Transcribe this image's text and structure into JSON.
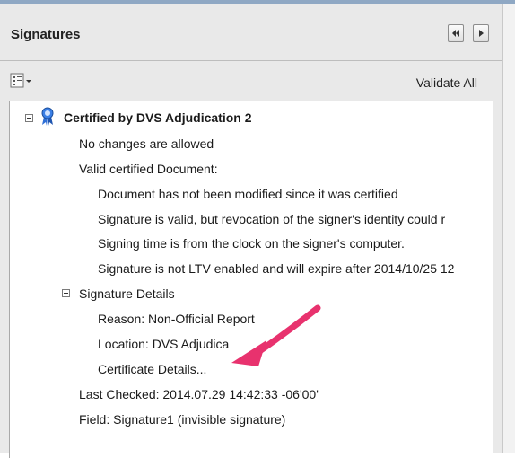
{
  "panel": {
    "title": "Signatures",
    "validate_all": "Validate All"
  },
  "tree": {
    "certified": "Certified by DVS Adjudication 2",
    "no_changes": "No changes are allowed",
    "valid_certified": "Valid certified Document:",
    "not_modified": "Document has not been modified since it was certified",
    "sig_valid": "Signature is valid, but revocation of the signer's identity could r",
    "signing_time": "Signing time is from the clock on the signer's computer.",
    "not_ltv": "Signature is not LTV enabled and will expire after 2014/10/25 12",
    "sig_details": "Signature Details",
    "reason": "Reason: Non-Official Report",
    "location": "Location: DVS Adjudica",
    "cert_details": "Certificate Details...",
    "last_checked": "Last Checked: 2014.07.29 14:42:33 -06'00'",
    "field": "Field: Signature1 (invisible signature)"
  },
  "colors": {
    "annotation_arrow": "#e8326e",
    "cert_ribbon": "#2f6fd6"
  }
}
